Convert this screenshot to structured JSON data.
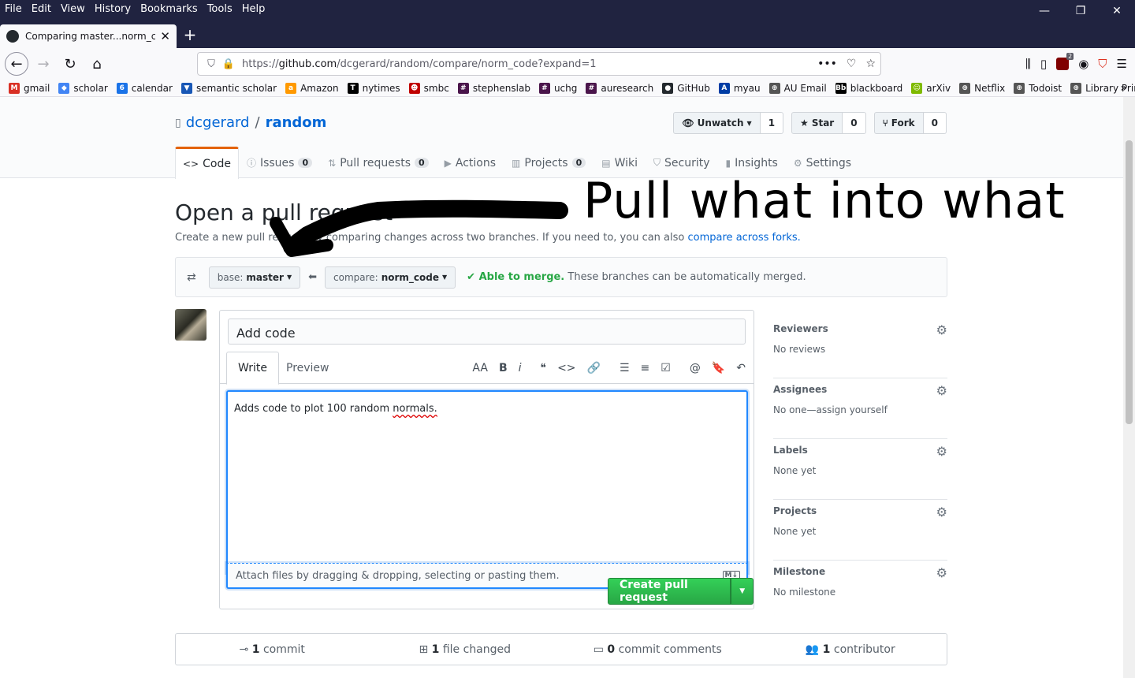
{
  "menu": [
    "File",
    "Edit",
    "View",
    "History",
    "Bookmarks",
    "Tools",
    "Help"
  ],
  "window_controls": {
    "minimize": "—",
    "restore": "❐",
    "close": "✕"
  },
  "tab": {
    "title": "Comparing master...norm_code",
    "close": "✕"
  },
  "newtab": "+",
  "url": {
    "prefix": "https://",
    "host": "github.com",
    "path": "/dcgerard/random/compare/norm_code?expand=1"
  },
  "bookmarks": [
    {
      "label": "gmail",
      "color": "#d93025",
      "glyph": "M"
    },
    {
      "label": "scholar",
      "color": "#4285f4",
      "glyph": "◆"
    },
    {
      "label": "calendar",
      "color": "#1a73e8",
      "glyph": "6"
    },
    {
      "label": "semantic scholar",
      "color": "#1857b6",
      "glyph": "▼"
    },
    {
      "label": "Amazon",
      "color": "#ff9900",
      "glyph": "a"
    },
    {
      "label": "nytimes",
      "color": "#000000",
      "glyph": "T"
    },
    {
      "label": "smbc",
      "color": "#c00000",
      "glyph": "☻"
    },
    {
      "label": "stephenslab",
      "color": "#4a154b",
      "glyph": "#"
    },
    {
      "label": "uchg",
      "color": "#4a154b",
      "glyph": "#"
    },
    {
      "label": "auresearch",
      "color": "#4a154b",
      "glyph": "#"
    },
    {
      "label": "GitHub",
      "color": "#24292e",
      "glyph": "●"
    },
    {
      "label": "myau",
      "color": "#003da5",
      "glyph": "A"
    },
    {
      "label": "AU Email",
      "color": "#555555",
      "glyph": "⊕"
    },
    {
      "label": "blackboard",
      "color": "#000000",
      "glyph": "Bb"
    },
    {
      "label": "arXiv",
      "color": "#7fba00",
      "glyph": "☺"
    },
    {
      "label": "Netflix",
      "color": "#555555",
      "glyph": "⊕"
    },
    {
      "label": "Todoist",
      "color": "#555555",
      "glyph": "⊕"
    },
    {
      "label": "Library Printing",
      "color": "#555555",
      "glyph": "⊕"
    }
  ],
  "repo": {
    "owner": "dcgerard",
    "sep": "/",
    "name": "random"
  },
  "actions": {
    "unwatch": {
      "label": "Unwatch",
      "count": "1"
    },
    "star": {
      "label": "Star",
      "count": "0"
    },
    "fork": {
      "label": "Fork",
      "count": "0"
    }
  },
  "nav": [
    {
      "label": "Code",
      "icon": "<>",
      "count": ""
    },
    {
      "label": "Issues",
      "icon": "ⓘ",
      "count": "0"
    },
    {
      "label": "Pull requests",
      "icon": "⇅",
      "count": "0"
    },
    {
      "label": "Actions",
      "icon": "▶",
      "count": ""
    },
    {
      "label": "Projects",
      "icon": "▥",
      "count": "0"
    },
    {
      "label": "Wiki",
      "icon": "▤",
      "count": ""
    },
    {
      "label": "Security",
      "icon": "⛉",
      "count": ""
    },
    {
      "label": "Insights",
      "icon": "▮",
      "count": ""
    },
    {
      "label": "Settings",
      "icon": "⚙",
      "count": ""
    }
  ],
  "subhead": {
    "title": "Open a pull request",
    "desc": "Create a new pull request by comparing changes across two branches. If you need to, you can also",
    "link": "compare across forks."
  },
  "annotation": "Pull what into what",
  "range": {
    "base_prefix": "base:",
    "base": "master",
    "compare_prefix": "compare:",
    "compare": "norm_code",
    "merge_ok": "Able to merge.",
    "merge_text": "These branches can be automatically merged."
  },
  "form": {
    "title_value": "Add code",
    "write": "Write",
    "preview": "Preview",
    "body_before": "Adds code to plot 100 random ",
    "body_spell": "normals.",
    "attach": "Attach files by dragging & dropping, selecting or pasting them.",
    "md": "M↓",
    "create": "Create pull request"
  },
  "toolbar": [
    "AA",
    "B",
    "i",
    "❝",
    "<>",
    "🔗",
    "☰",
    "≡",
    "☑",
    "@",
    "🔖",
    "↶"
  ],
  "sidebar": [
    {
      "title": "Reviewers",
      "value": "No reviews"
    },
    {
      "title": "Assignees",
      "value": "No one—assign yourself"
    },
    {
      "title": "Labels",
      "value": "None yet"
    },
    {
      "title": "Projects",
      "value": "None yet"
    },
    {
      "title": "Milestone",
      "value": "No milestone"
    }
  ],
  "summary": [
    {
      "icon": "⊸",
      "num": "1",
      "label": "commit"
    },
    {
      "icon": "⊞",
      "num": "1",
      "label": "file changed"
    },
    {
      "icon": "▭",
      "num": "0",
      "label": "commit comments"
    },
    {
      "icon": "👥",
      "num": "1",
      "label": "contributor"
    }
  ]
}
